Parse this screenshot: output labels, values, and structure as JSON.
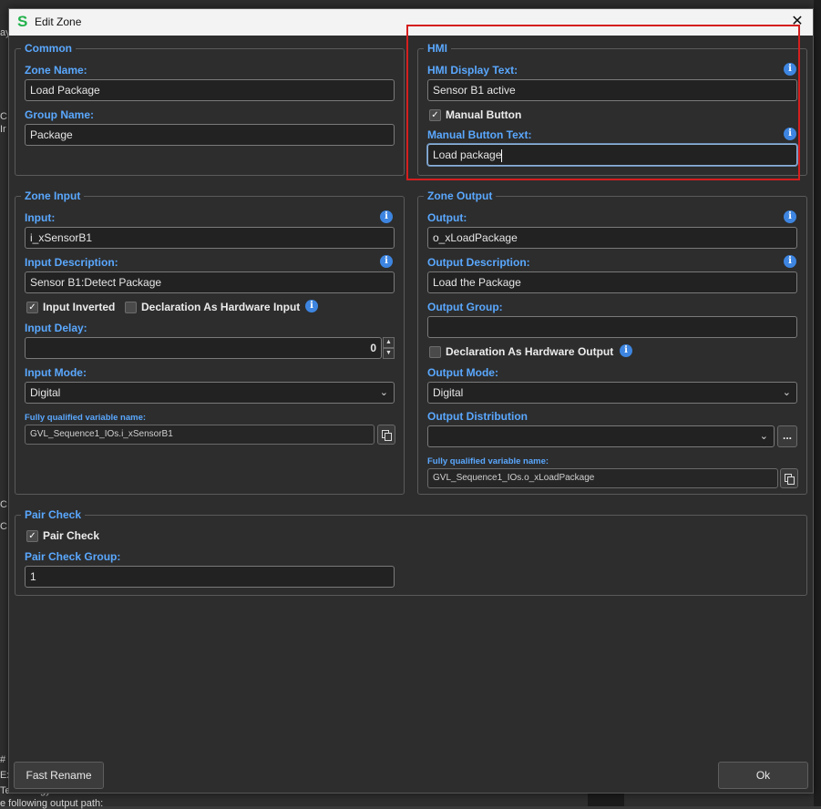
{
  "window": {
    "title": "Edit Zone",
    "logo": "S"
  },
  "background": {
    "lines": [
      "ay",
      "C",
      "Ir",
      "C",
      "C",
      "#",
      "Ex",
      "Technology GmbH\\SELMOstudio : Access is denied.",
      "e following output path:"
    ]
  },
  "common": {
    "title": "Common",
    "zone_name_label": "Zone Name:",
    "zone_name_value": "Load Package",
    "group_name_label": "Group Name:",
    "group_name_value": "Package"
  },
  "hmi": {
    "title": "HMI",
    "display_text_label": "HMI Display Text:",
    "display_text_value": "Sensor B1 active",
    "manual_button_label": "Manual Button",
    "manual_button_checked": true,
    "manual_button_text_label": "Manual Button Text:",
    "manual_button_text_value": "Load package"
  },
  "zone_input": {
    "title": "Zone Input",
    "input_label": "Input:",
    "input_value": "i_xSensorB1",
    "description_label": "Input Description:",
    "description_value": "Sensor B1:Detect Package",
    "inverted_label": "Input Inverted",
    "inverted_checked": true,
    "hw_input_label": "Declaration As Hardware Input",
    "hw_input_checked": false,
    "delay_label": "Input Delay:",
    "delay_value": "0",
    "mode_label": "Input Mode:",
    "mode_value": "Digital",
    "fq_label": "Fully qualified variable name:",
    "fq_value": "GVL_Sequence1_IOs.i_xSensorB1"
  },
  "zone_output": {
    "title": "Zone Output",
    "output_label": "Output:",
    "output_value": "o_xLoadPackage",
    "description_label": "Output Description:",
    "description_value": "Load the Package",
    "group_label": "Output Group:",
    "group_value": "",
    "hw_output_label": "Declaration As Hardware Output",
    "hw_output_checked": false,
    "mode_label": "Output Mode:",
    "mode_value": "Digital",
    "distribution_label": "Output Distribution",
    "distribution_value": "",
    "more_label": "...",
    "fq_label": "Fully qualified variable name:",
    "fq_value": "GVL_Sequence1_IOs.o_xLoadPackage"
  },
  "pair_check": {
    "title": "Pair Check",
    "pair_check_label": "Pair Check",
    "pair_check_checked": true,
    "group_label": "Pair Check Group:",
    "group_value": "1"
  },
  "footer": {
    "fast_rename_label": "Fast Rename",
    "ok_label": "Ok"
  },
  "icons": {
    "info": "i",
    "check": "✓",
    "chevron": "⌄",
    "close": "✕"
  },
  "colors": {
    "accent": "#5aa8ff",
    "highlight": "#d51e1e",
    "logo": "#22b24c"
  }
}
